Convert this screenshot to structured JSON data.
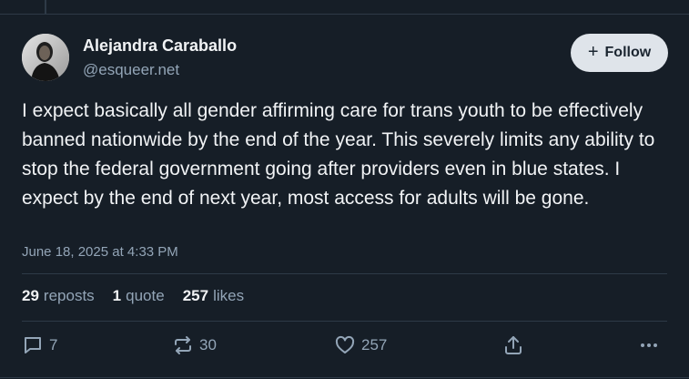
{
  "author": {
    "name": "Alejandra Caraballo",
    "handle": "@esqueer.net"
  },
  "follow_button": {
    "icon": "plus-icon",
    "label": "Follow"
  },
  "post": {
    "text": "I expect basically all gender affirming care for trans youth to be effectively banned nationwide by the end of the year. This severely limits any ability to stop the federal government going after providers even in blue states. I expect by the end of next year, most access for adults will be gone.",
    "timestamp": "June 18, 2025 at 4:33 PM"
  },
  "stats": {
    "reposts_count": "29",
    "reposts_label": "reposts",
    "quotes_count": "1",
    "quotes_label": "quote",
    "likes_count": "257",
    "likes_label": "likes"
  },
  "actions": {
    "reply_count": "7",
    "repost_count": "30",
    "like_count": "257"
  },
  "colors": {
    "background": "#161e27",
    "text": "#f1f3f5",
    "muted": "#93a5b7",
    "divider": "#2e3a47",
    "follow_bg": "#dfe4ea"
  }
}
